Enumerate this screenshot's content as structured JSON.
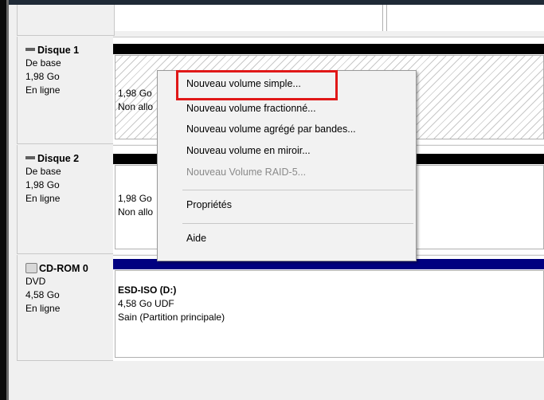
{
  "disks": [
    {
      "title": "Disque 1",
      "type": "De base",
      "size": "1,98 Go",
      "status": "En ligne",
      "volume": {
        "size": "1,98 Go",
        "state": "Non allo"
      }
    },
    {
      "title": "Disque 2",
      "type": "De base",
      "size": "1,98 Go",
      "status": "En ligne",
      "volume": {
        "size": "1,98 Go",
        "state": "Non allo"
      }
    },
    {
      "title": "CD-ROM 0",
      "type": "DVD",
      "size": "4,58 Go",
      "status": "En ligne",
      "volume": {
        "name": "ESD-ISO  (D:)",
        "size": "4,58 Go UDF",
        "state": "Sain (Partition principale)"
      }
    }
  ],
  "context_menu": {
    "items": [
      {
        "label": "Nouveau volume simple...",
        "enabled": true
      },
      {
        "label": "Nouveau volume fractionné...",
        "enabled": true
      },
      {
        "label": "Nouveau volume agrégé par bandes...",
        "enabled": true
      },
      {
        "label": "Nouveau volume en miroir...",
        "enabled": true
      },
      {
        "label": "Nouveau Volume RAID-5...",
        "enabled": false
      },
      {
        "label": "Propriétés",
        "enabled": true
      },
      {
        "label": "Aide",
        "enabled": true
      }
    ]
  },
  "colors": {
    "highlight": "#e01818",
    "primary_bar": "#000080",
    "unallocated_bar": "#000000"
  }
}
